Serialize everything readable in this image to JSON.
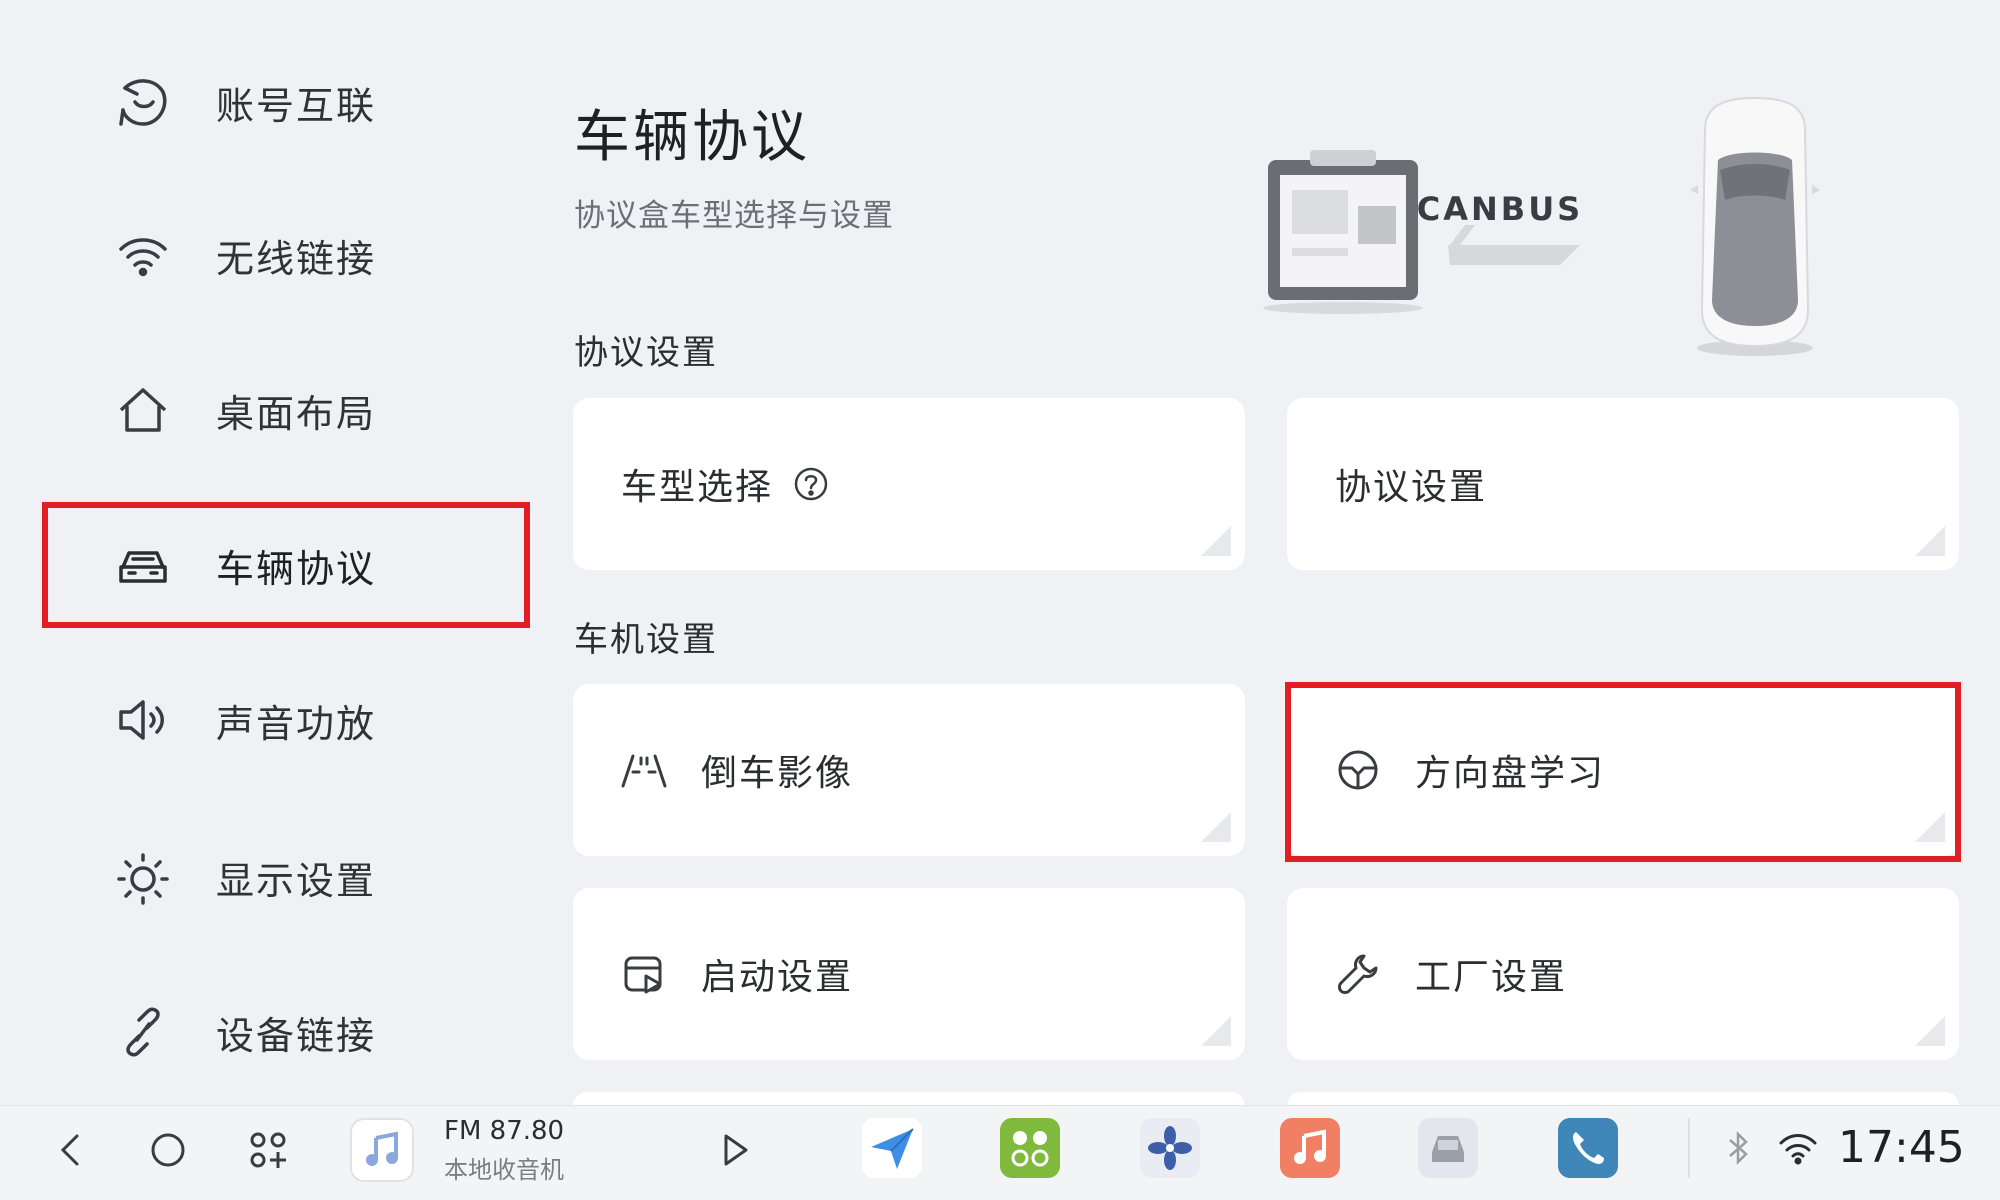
{
  "sidebar": {
    "items": [
      {
        "label": "账号互联",
        "icon": "account-link-icon"
      },
      {
        "label": "无线链接",
        "icon": "wifi-icon"
      },
      {
        "label": "桌面布局",
        "icon": "home-icon"
      },
      {
        "label": "车辆协议",
        "icon": "car-icon",
        "active": true
      },
      {
        "label": "声音功放",
        "icon": "speaker-icon"
      },
      {
        "label": "显示设置",
        "icon": "brightness-icon"
      },
      {
        "label": "设备链接",
        "icon": "link-icon"
      }
    ]
  },
  "header": {
    "title": "车辆协议",
    "subtitle": "协议盒车型选择与设置",
    "illustration_label": "CANBUS"
  },
  "sections": {
    "protocol": {
      "title": "协议设置",
      "cards": [
        {
          "label": "车型选择",
          "has_help": true
        },
        {
          "label": "协议设置"
        }
      ]
    },
    "head_unit": {
      "title": "车机设置",
      "cards": [
        {
          "label": "倒车影像",
          "icon": "reverse-camera-icon"
        },
        {
          "label": "方向盘学习",
          "icon": "steering-wheel-icon",
          "highlighted": true
        },
        {
          "label": "启动设置",
          "icon": "startup-icon"
        },
        {
          "label": "工厂设置",
          "icon": "wrench-icon"
        }
      ]
    }
  },
  "bottombar": {
    "nav": [
      "back-icon",
      "home-circle-icon",
      "apps-grid-icon"
    ],
    "media": {
      "title": "FM 87.80",
      "subtitle": "本地收音机"
    },
    "dock": [
      "navigation-app",
      "apps-app",
      "fan-app",
      "music-app",
      "car-app",
      "phone-app"
    ],
    "clock": "17:45"
  },
  "colors": {
    "background": "#eff1f4",
    "card": "#ffffff",
    "highlight": "#e01e24"
  }
}
